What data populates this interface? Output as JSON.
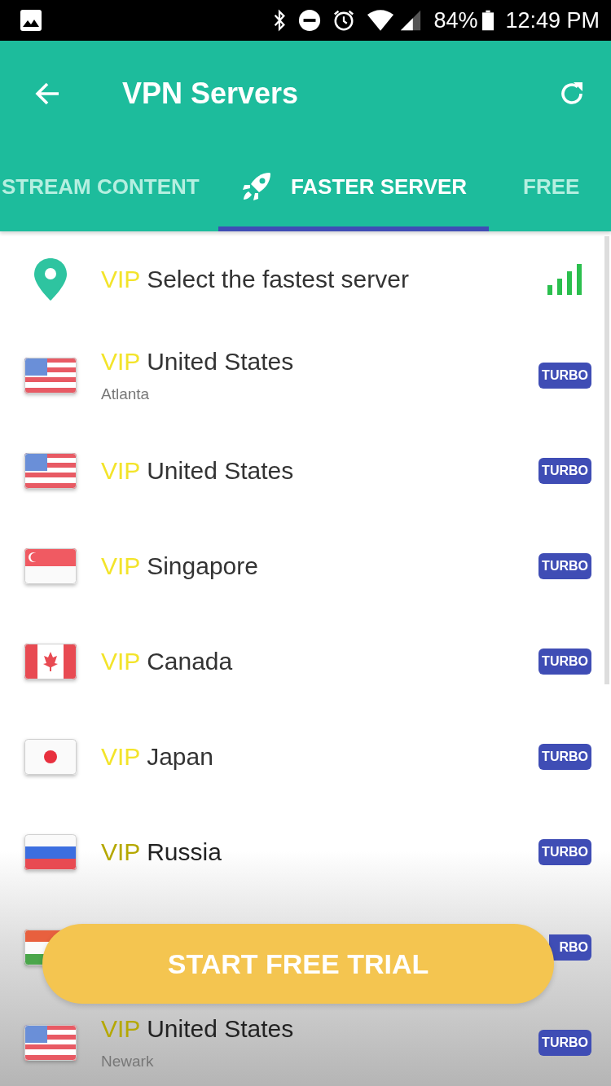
{
  "status_bar": {
    "battery": "84%",
    "time": "12:49 PM"
  },
  "app_bar": {
    "title": "VPN Servers"
  },
  "tabs": [
    {
      "label": "STREAM CONTENT",
      "selected": false
    },
    {
      "label": "FASTER SERVER",
      "selected": true,
      "kind": "rocket"
    },
    {
      "label": "FREE",
      "selected": false
    }
  ],
  "servers": [
    {
      "kind": "auto",
      "tag": "VIP",
      "name": "Select the fastest server"
    },
    {
      "kind": "country",
      "flag": {
        "kind": "us"
      },
      "tag": "VIP",
      "name": "United States",
      "city": "Atlanta",
      "badge": "TURBO"
    },
    {
      "kind": "country",
      "flag": {
        "kind": "us"
      },
      "tag": "VIP",
      "name": "United States",
      "badge": "TURBO"
    },
    {
      "kind": "country",
      "flag": {
        "kind": "sg"
      },
      "tag": "VIP",
      "name": "Singapore",
      "badge": "TURBO"
    },
    {
      "kind": "country",
      "flag": {
        "kind": "ca"
      },
      "tag": "VIP",
      "name": "Canada",
      "badge": "TURBO"
    },
    {
      "kind": "country",
      "flag": {
        "kind": "jp"
      },
      "tag": "VIP",
      "name": "Japan",
      "badge": "TURBO"
    },
    {
      "kind": "country",
      "flag": {
        "kind": "ru"
      },
      "tag": "VIP",
      "name": "Russia",
      "badge": "TURBO"
    },
    {
      "kind": "covered",
      "flag": {
        "kind": "hu"
      },
      "badge": "RBO"
    },
    {
      "kind": "country",
      "flag": {
        "kind": "us"
      },
      "tag": "VIP",
      "name": "United States",
      "city": "Newark",
      "badge": "TURBO"
    }
  ],
  "cta": {
    "label": "START FREE TRIAL"
  }
}
